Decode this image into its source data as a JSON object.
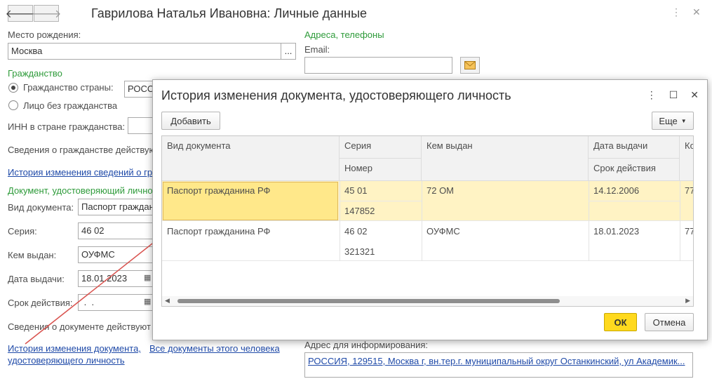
{
  "window": {
    "title": "Гаврилова Наталья Ивановна: Личные данные"
  },
  "form": {
    "birthplace_label": "Место рождения:",
    "birthplace_value": "Москва",
    "birthplace_btn": "...",
    "contacts_header": "Адреса, телефоны",
    "email_label": "Email:",
    "email_value": "",
    "citizenship_header": "Гражданство",
    "radio_country": "Гражданство страны:",
    "country_value": "РОССИЯ",
    "radio_stateless": "Лицо без гражданства",
    "inn_label": "ИНН в стране гражданства:",
    "citizenship_info": "Сведения о гражданстве действую",
    "citizenship_history_link": "История изменения сведений о гр",
    "doc_header": "Документ, удостоверяющий личнос",
    "doc_type_label": "Вид документа:",
    "doc_type_value": "Паспорт граждан",
    "series_label": "Серия:",
    "series_value": "46 02",
    "issued_by_label": "Кем выдан:",
    "issued_by_value": "ОУФМС",
    "issue_date_label": "Дата выдачи:",
    "issue_date_value": "18.01.2023",
    "valid_until_label": "Срок действия:",
    "valid_until_value": " .  .",
    "doc_info": "Сведения о документе действуют",
    "doc_history_link_1": "История изменения документа,",
    "doc_history_link_2": "удостоверяющего личность",
    "all_docs_link": "Все документы этого человека",
    "info_address_label": "Адрес для информирования:",
    "info_address_value": "РОССИЯ, 129515, Москва г, вн.тер.г. муниципальный округ Останкинский, ул Академик..."
  },
  "modal": {
    "title": "История изменения документа, удостоверяющего личность",
    "add_button": "Добавить",
    "more_button": "Еще",
    "ok_button": "ОК",
    "cancel_button": "Отмена",
    "columns": {
      "doc_type": "Вид документа",
      "series": "Серия",
      "number": "Номер",
      "issued_by": "Кем выдан",
      "issue_date": "Дата выдачи",
      "valid_until": "Срок действия",
      "code": "Ко"
    },
    "rows": [
      {
        "doc_type": "Паспорт гражданина РФ",
        "series": "45 01",
        "number": "147852",
        "issued_by": "72 ОМ",
        "issue_date": "14.12.2006",
        "valid_until": "",
        "code": "77"
      },
      {
        "doc_type": "Паспорт гражданина РФ",
        "series": "46 02",
        "number": "321321",
        "issued_by": "ОУФМС",
        "issue_date": "18.01.2023",
        "valid_until": "",
        "code": "77"
      }
    ]
  },
  "colors": {
    "accent_green": "#2e9b3a",
    "link_blue": "#1f4aa8",
    "ok_yellow": "#ffd91e",
    "selection": "#ffe88a",
    "annotation_arrow": "#d9534f"
  }
}
